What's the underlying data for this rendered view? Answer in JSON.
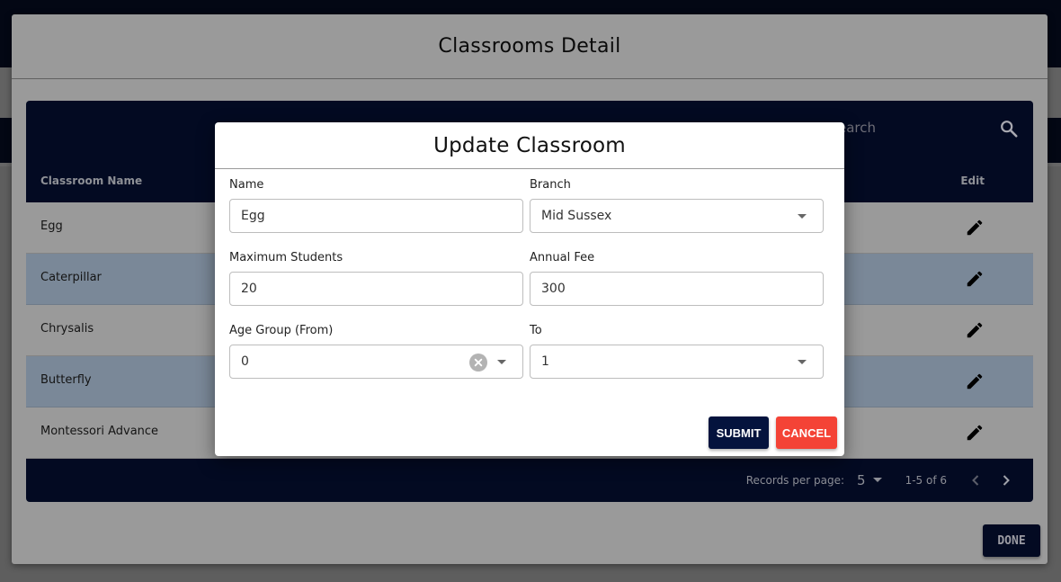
{
  "outer_dialog": {
    "title": "Classrooms Detail",
    "search_placeholder": "earch",
    "table": {
      "columns": [
        "Classroom Name",
        "Edit"
      ],
      "rows": [
        {
          "name": "Egg"
        },
        {
          "name": "Caterpillar"
        },
        {
          "name": "Chrysalis"
        },
        {
          "name": "Butterfly"
        },
        {
          "name": "Montessori Advance"
        }
      ]
    },
    "pagination": {
      "records_per_page_label": "Records per page:",
      "records_per_page_value": "5",
      "range": "1-5 of 6"
    },
    "done_label": "DONE"
  },
  "modal": {
    "title": "Update Classroom",
    "fields": {
      "name": {
        "label": "Name",
        "value": "Egg"
      },
      "branch": {
        "label": "Branch",
        "value": "Mid Sussex"
      },
      "max_students": {
        "label": "Maximum Students",
        "value": "20"
      },
      "annual_fee": {
        "label": "Annual Fee",
        "value": "300"
      },
      "age_from": {
        "label": "Age Group (From)",
        "value": "0"
      },
      "age_to": {
        "label": "To",
        "value": "1"
      }
    },
    "submit_label": "SUBMIT",
    "cancel_label": "CANCEL"
  },
  "colors": {
    "navy": "#030a22",
    "cancel_red": "#f44336",
    "submit_navy": "#04133d",
    "alt_row": "#7a8898"
  }
}
